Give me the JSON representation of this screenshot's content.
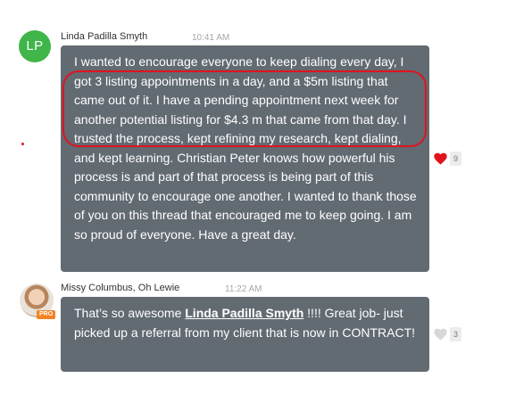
{
  "messages": [
    {
      "avatar_initials": "LP",
      "author": "Linda Padilla Smyth",
      "time": "10:41 AM",
      "body": "I wanted to encourage everyone to keep dialing every day, I got 3 listing appointments in a day, and a $5m listing that came out of it.   I have a pending appointment next week for another potential listing for $4.3 m that came from that day.    I trusted the process, kept refining my research, kept dialing, and kept learning.    Christian Peter knows how powerful his process is and part of that process is being part of this community to encourage one another.  I wanted to thank those of you on this thread that encouraged me to keep going.    I am so proud of everyone.   Have a great day.",
      "like_count": "9",
      "liked": true,
      "like_icon": "heart-icon"
    },
    {
      "author": "Missy Columbus, Oh Lewie",
      "time": "11:22 AM",
      "badge": "PRO",
      "body_before": "That’s so awesome ",
      "mention": "Linda Padilla Smyth",
      "body_after": " !!!! Great job- just picked up a referral from my client that is now in CONTRACT!",
      "like_count": "3",
      "liked": false,
      "like_icon": "heart-icon"
    }
  ],
  "colors": {
    "bubble": "#626a72",
    "avatar_lp": "#40b549",
    "highlight": "#e0131f",
    "heart_active": "#e0131f",
    "heart_inactive": "#d7d7d7",
    "pro_badge": "#f58220"
  }
}
